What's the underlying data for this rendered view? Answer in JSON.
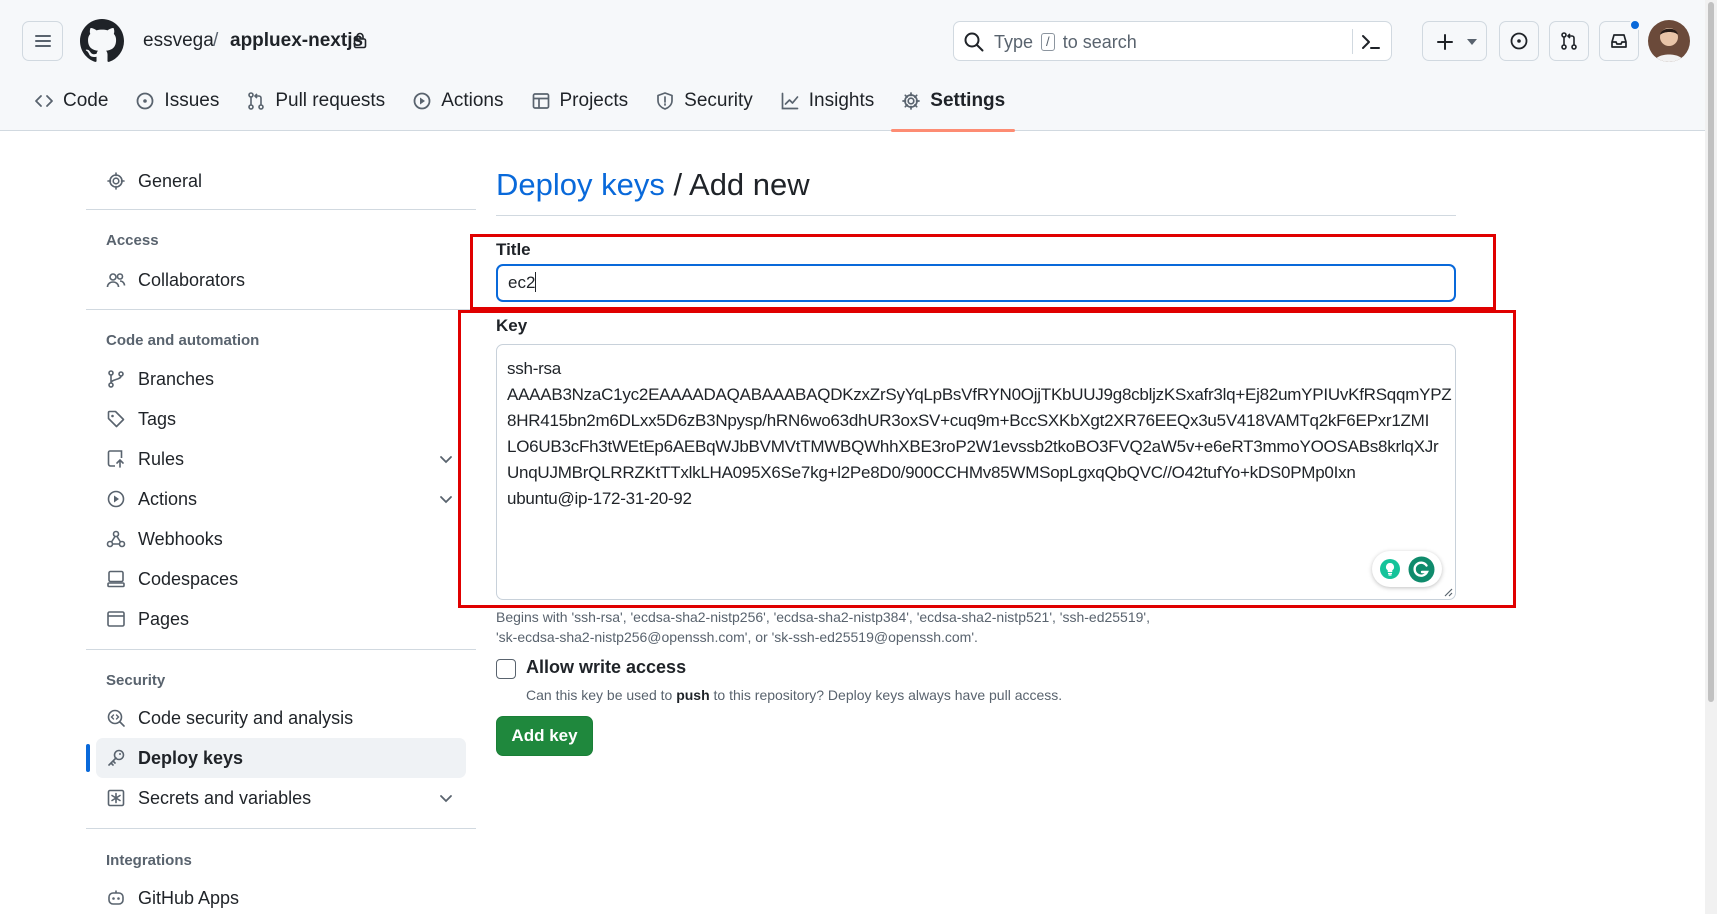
{
  "header": {
    "owner": "essvega",
    "separator": "/",
    "repo": "appluex-nextjs",
    "search_pre": "Type",
    "search_key": "/",
    "search_post": "to search"
  },
  "tabs": [
    {
      "label": "Code",
      "icon": "code-icon"
    },
    {
      "label": "Issues",
      "icon": "issue-icon"
    },
    {
      "label": "Pull requests",
      "icon": "pull-request-icon"
    },
    {
      "label": "Actions",
      "icon": "play-icon"
    },
    {
      "label": "Projects",
      "icon": "table-icon"
    },
    {
      "label": "Security",
      "icon": "shield-icon"
    },
    {
      "label": "Insights",
      "icon": "graph-icon"
    },
    {
      "label": "Settings",
      "icon": "gear-icon",
      "active": true
    }
  ],
  "sidebar": {
    "general": "General",
    "access_heading": "Access",
    "collaborators": "Collaborators",
    "code_heading": "Code and automation",
    "branches": "Branches",
    "tags": "Tags",
    "rules": "Rules",
    "actions": "Actions",
    "webhooks": "Webhooks",
    "codespaces": "Codespaces",
    "pages": "Pages",
    "security_heading": "Security",
    "code_security": "Code security and analysis",
    "deploy_keys": "Deploy keys",
    "secrets": "Secrets and variables",
    "integrations_heading": "Integrations",
    "github_apps": "GitHub Apps"
  },
  "main": {
    "title_link": "Deploy keys",
    "title_sep": "/",
    "title_rest": "Add new",
    "title_label": "Title",
    "title_value": "ec2",
    "key_label": "Key",
    "key_lines": [
      "ssh-rsa",
      "AAAAB3NzaC1yc2EAAAADAQABAAABAQDKzxZrSyYqLpBsVfRYN0OjjTKbUUJ9g8cbljzKSxafr3lq+Ej82umYPIUvKfRSqqmYPZ",
      "8HR415bn2m6DLxx5D6zB3Npysp/hRN6wo63dhUR3oxSV+cuq9m+BccSXKbXgt2XR76EEQx3u5V418VAMTq2kF6EPxr1ZMI",
      "LO6UB3cFh3tWEtEp6AEBqWJbBVMVtTMWBQWhhXBE3roP2W1evssb2tkoBO3FVQ2aW5v+e6eRT3mmoYOOSABs8krlqXJr",
      "UnqUJMBrQLRRZKtTTxlkLHA095X6Se7kg+l2Pe8D0/900CCHMv85WMSopLgxqQbQVC//O42tufYo+kDS0PMp0Ixn",
      "ubuntu@ip-172-31-20-92"
    ],
    "hint_line1": "Begins with 'ssh-rsa', 'ecdsa-sha2-nistp256', 'ecdsa-sha2-nistp384', 'ecdsa-sha2-nistp521', 'ssh-ed25519',",
    "hint_line2": "'sk-ecdsa-sha2-nistp256@openssh.com', or 'sk-ssh-ed25519@openssh.com'.",
    "allow_write_label": "Allow write access",
    "allow_write_note_pre": "Can this key be used to",
    "allow_write_note_bold": "push",
    "allow_write_note_post": "to this repository? Deploy keys always have pull access.",
    "allow_write_checked": false,
    "add_key_button": "Add key"
  },
  "colors": {
    "accent": "#0969da",
    "primary_button": "#1f883d",
    "active_tab_underline": "#fd8c73",
    "annotation_red": "#e00000"
  }
}
